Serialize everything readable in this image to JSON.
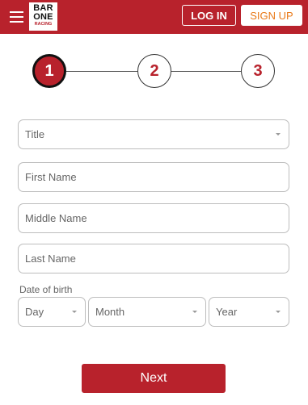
{
  "header": {
    "logo_line1": "BAR",
    "logo_line2": "ONE",
    "logo_line3": "RACING",
    "login_label": "LOG IN",
    "signup_label": "SIGN UP"
  },
  "steps": {
    "current": 1,
    "labels": [
      "1",
      "2",
      "3"
    ]
  },
  "form": {
    "title_placeholder": "Title",
    "first_name_placeholder": "First Name",
    "middle_name_placeholder": "Middle Name",
    "last_name_placeholder": "Last Name",
    "dob_label": "Date of birth",
    "day_placeholder": "Day",
    "month_placeholder": "Month",
    "year_placeholder": "Year",
    "next_label": "Next"
  },
  "colors": {
    "brand_red": "#b8222c",
    "signup_orange": "#e97a1a"
  }
}
